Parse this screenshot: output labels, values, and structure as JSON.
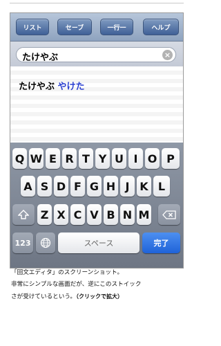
{
  "toolbar": {
    "list_label": "リスト",
    "save_label": "セーブ",
    "center_label": "一行一",
    "help_label": "ヘルプ"
  },
  "search": {
    "value": "たけやぶ"
  },
  "result": {
    "original": "たけやぶ",
    "reversed": "やけた"
  },
  "keyboard": {
    "row1": [
      "Q",
      "W",
      "E",
      "R",
      "T",
      "Y",
      "U",
      "I",
      "O",
      "P"
    ],
    "row2": [
      "A",
      "S",
      "D",
      "F",
      "G",
      "H",
      "J",
      "K",
      "L"
    ],
    "row3": [
      "Z",
      "X",
      "C",
      "V",
      "B",
      "N",
      "M"
    ],
    "numbers_label": "123",
    "space_label": "スペース",
    "done_label": "完了"
  },
  "caption": {
    "line1": "「回文エディタ」のスクリーンショット。",
    "line2": "非常にシンプルな画面だが、逆にこのストイック",
    "line3_text": "さが受けているという。",
    "line3_link": "（クリックで拡大）"
  },
  "colors": {
    "accent_blue": "#2a3fd0",
    "done_button": "#1f63d8"
  }
}
